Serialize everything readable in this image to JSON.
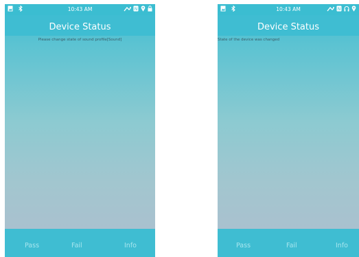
{
  "left_screen": {
    "status_bar": {
      "time": "10:43 AM",
      "icons_left": [
        "gallery-icon",
        "bluetooth-icon"
      ],
      "icons_right": [
        "signal-icon",
        "nfc-icon",
        "location-icon",
        "lock-icon"
      ]
    },
    "title": "Device Status",
    "message": "Please change state of sound profile[Sound]",
    "buttons": {
      "pass": "Pass",
      "fail": "Fail",
      "info": "Info"
    }
  },
  "right_screen": {
    "status_bar": {
      "time": "10:43 AM",
      "icons_left": [
        "gallery-icon",
        "bluetooth-icon"
      ],
      "icons_right": [
        "signal-icon",
        "nfc-icon",
        "headset-icon",
        "location-icon"
      ]
    },
    "title": "Device Status",
    "message": "State of the device was changed",
    "buttons": {
      "pass": "Pass",
      "fail": "Fail",
      "info": "Info"
    }
  },
  "colors": {
    "accent": "#3fbdd2",
    "button_text": "#a8e6ef",
    "message_text": "#3a5a66"
  }
}
